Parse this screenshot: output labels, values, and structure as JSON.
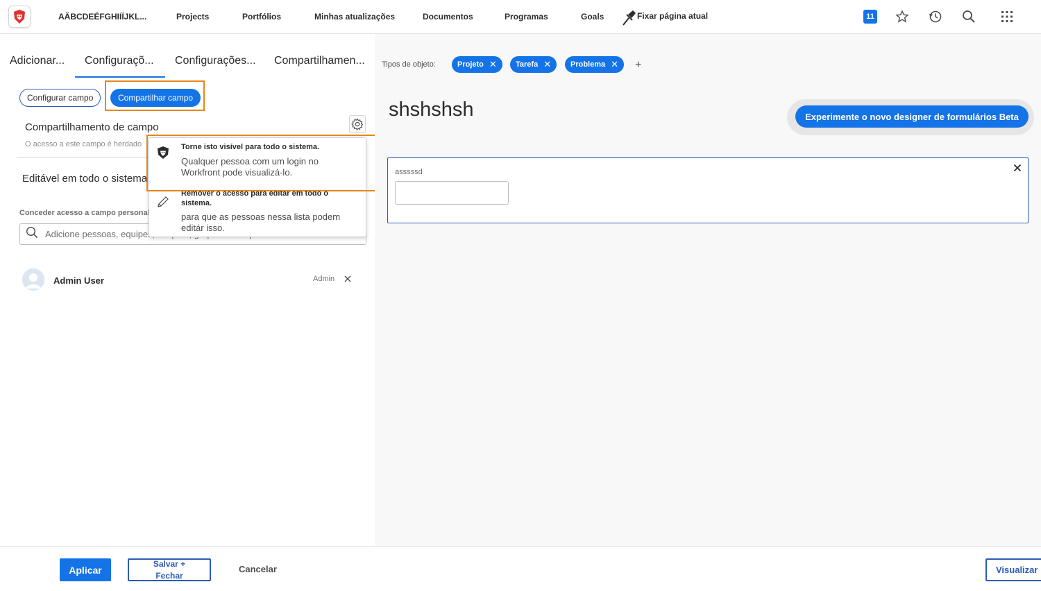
{
  "nav": {
    "org_name": "AÄBCDEÉFGHIIÏJKL...",
    "items": [
      "Projects",
      "Portfólios",
      "Minhas atualizações",
      "Documentos",
      "Programas",
      "Goals"
    ],
    "pin_label": "Fixar página atual",
    "notification_count": "11",
    "icons": [
      "brand-logo-icon",
      "pin-icon",
      "star-icon",
      "history-icon",
      "search-icon",
      "apps-grid-icon"
    ]
  },
  "left": {
    "tabs": [
      "Adicionar...",
      "Configuraçõ...",
      "Configurações...",
      "Compartilhamen..."
    ],
    "active_tab_index": 1,
    "configure_btn": "Configurar campo",
    "share_btn": "Compartilhar campo",
    "section_title": "Compartilhamento de campo",
    "section_sub": "O acesso a este campo é herdado",
    "editable_label": "Editável em todo o sistema",
    "grant_label": "Conceder acesso a campo personalizado",
    "search_placeholder": "Adicione pessoas, equipes, funções, grupos ou empresas",
    "user": {
      "name": "Admin User",
      "role": "Admin"
    }
  },
  "popover": {
    "option1": {
      "title": "Torne isto visível para todo o sistema.",
      "desc": "Qualquer pessoa com um login no Workfront pode visualizá-lo."
    },
    "option2": {
      "title": "Remover o acesso para editar em todo o sistema.",
      "desc": "para que as pessoas nessa lista podem editár isso."
    }
  },
  "right": {
    "object_types_label": "Tipos de objeto:",
    "object_types": [
      "Projeto",
      "Tarefa",
      "Problema"
    ],
    "add_symbol": "+",
    "form_title": "shshshsh",
    "beta_button": "Experimente o novo designer de formulários Beta",
    "field_label": "asssssd",
    "field_value": ""
  },
  "bottom": {
    "apply": "Aplicar",
    "save_close": "Salvar + Fechar",
    "cancel": "Cancelar",
    "preview": "Visualizar"
  },
  "colors": {
    "accent": "#1473e6",
    "highlight": "#e68619",
    "brand": "#e03030"
  }
}
